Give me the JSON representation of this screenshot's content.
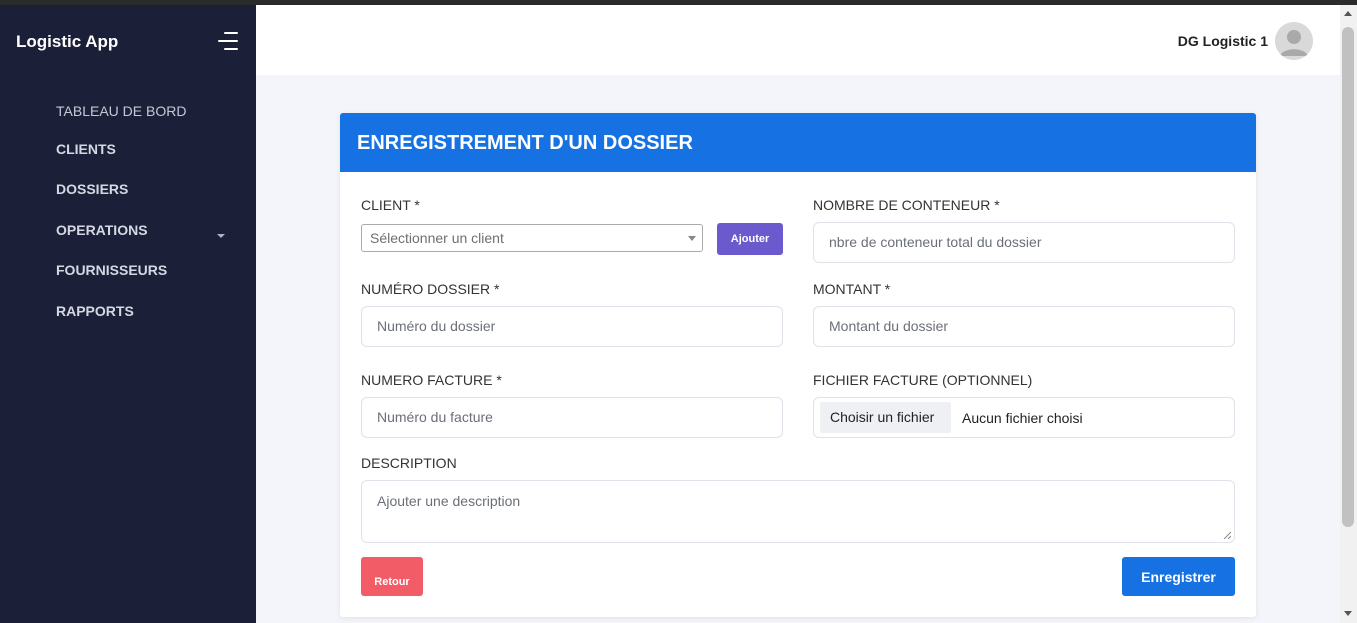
{
  "app": {
    "title": "Logistic App"
  },
  "sidebar": {
    "items": [
      {
        "label": "TABLEAU DE BORD"
      },
      {
        "label": "CLIENTS"
      },
      {
        "label": "DOSSIERS"
      },
      {
        "label": "OPERATIONS"
      },
      {
        "label": "FOURNISSEURS"
      },
      {
        "label": "RAPPORTS"
      }
    ]
  },
  "header": {
    "user_name": "DG Logistic 1"
  },
  "form": {
    "title": "ENREGISTREMENT D'UN DOSSIER",
    "client": {
      "label": "CLIENT *",
      "selected": "Sélectionner un client",
      "add_button": "Ajouter"
    },
    "containers": {
      "label": "NOMBRE DE CONTENEUR *",
      "placeholder": "nbre de conteneur total du dossier"
    },
    "dossier_number": {
      "label": "NUMÉRO DOSSIER *",
      "placeholder": "Numéro du dossier"
    },
    "amount": {
      "label": "MONTANT *",
      "placeholder": "Montant du dossier"
    },
    "invoice_number": {
      "label": "NUMERO FACTURE *",
      "placeholder": "Numéro du facture"
    },
    "invoice_file": {
      "label": "FICHIER FACTURE (OPTIONNEL)",
      "button": "Choisir un fichier",
      "status": "Aucun fichier choisi"
    },
    "description": {
      "label": "DESCRIPTION",
      "placeholder": "Ajouter une description"
    },
    "back_button": "Retour",
    "save_button": "Enregistrer"
  },
  "colors": {
    "sidebar_bg": "#1b2038",
    "primary": "#1672e2",
    "add_button": "#6a5acd",
    "back_button": "#f25c66"
  },
  "icons": {
    "menu_toggle": "menu-lines-icon",
    "avatar": "user-avatar-icon",
    "dropdown": "caret-down-icon"
  }
}
